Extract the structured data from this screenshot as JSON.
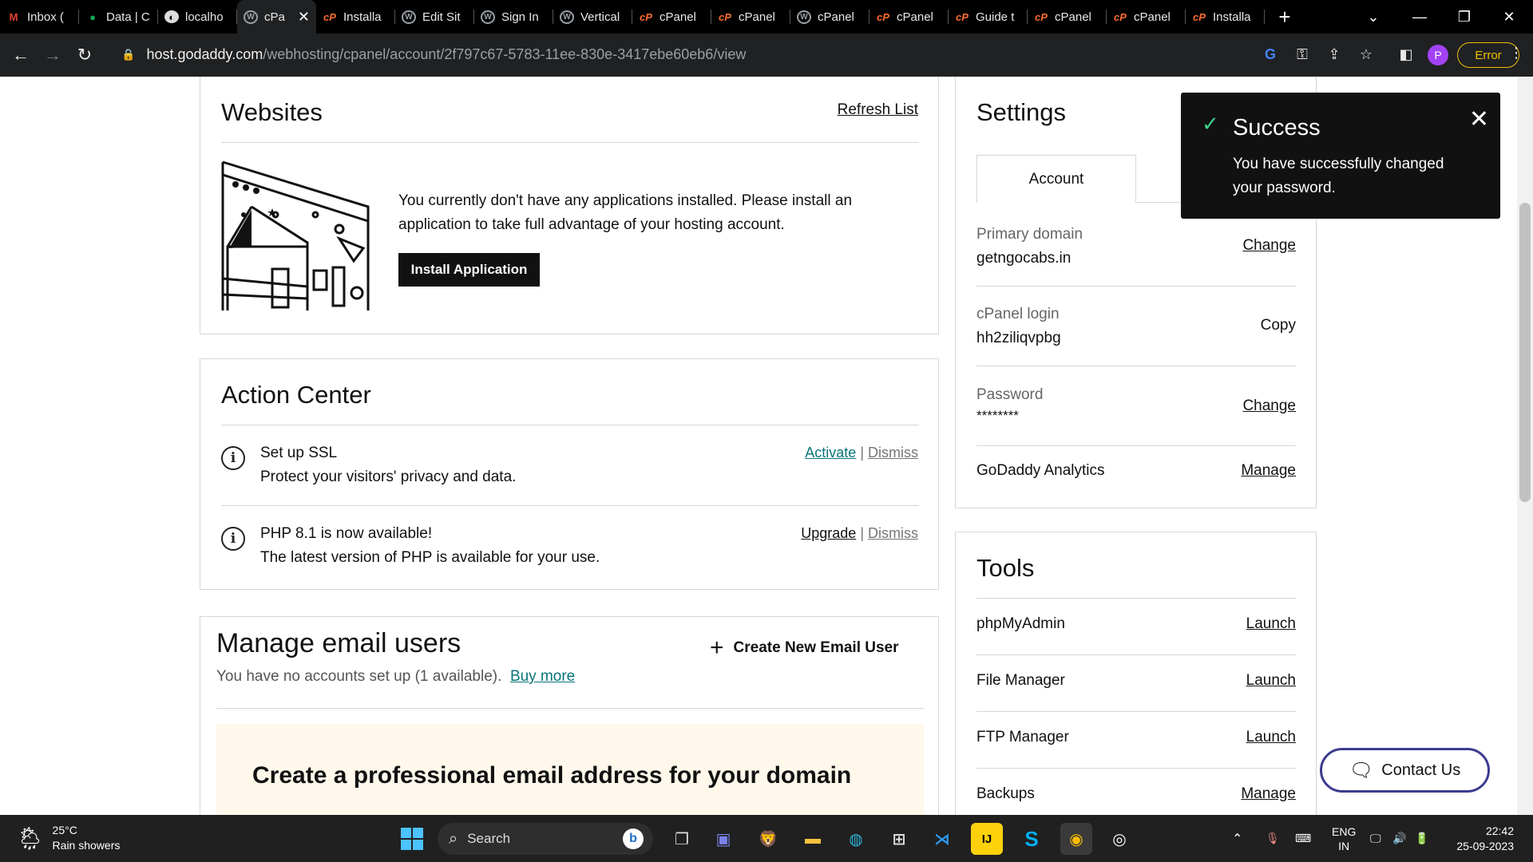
{
  "browser": {
    "tabs": [
      {
        "label": "Inbox (",
        "fav": "M",
        "fclass": "fav-gmail"
      },
      {
        "label": "Data | C",
        "fav": "●",
        "fclass": "fav-mongo"
      },
      {
        "label": "localho",
        "fav": "◐",
        "fclass": "fav-local"
      },
      {
        "label": "cPa",
        "fav": "W",
        "fclass": "fav-wp",
        "active": true
      },
      {
        "label": "Installa",
        "fav": "cP",
        "fclass": "fav-cpanel"
      },
      {
        "label": "Edit Sit",
        "fav": "W",
        "fclass": "fav-wp"
      },
      {
        "label": "Sign In",
        "fav": "W",
        "fclass": "fav-wp"
      },
      {
        "label": "Vertical",
        "fav": "W",
        "fclass": "fav-wp"
      },
      {
        "label": "cPanel",
        "fav": "cP",
        "fclass": "fav-cpanel"
      },
      {
        "label": "cPanel",
        "fav": "cP",
        "fclass": "fav-cpanel"
      },
      {
        "label": "cPanel",
        "fav": "W",
        "fclass": "fav-wp"
      },
      {
        "label": "cPanel",
        "fav": "cP",
        "fclass": "fav-cpanel"
      },
      {
        "label": "Guide t",
        "fav": "cP",
        "fclass": "fav-cpanel"
      },
      {
        "label": "cPanel",
        "fav": "cP",
        "fclass": "fav-cpanel"
      },
      {
        "label": "cPanel",
        "fav": "cP",
        "fclass": "fav-cpanel"
      },
      {
        "label": "Installa",
        "fav": "cP",
        "fclass": "fav-cpanel"
      }
    ],
    "url_host": "host.godaddy.com",
    "url_path": "/webhosting/cpanel/account/2f797c67-5783-11ee-830e-3417ebe60eb6/view",
    "profile_initial": "P",
    "error_label": "Error"
  },
  "websites": {
    "title": "Websites",
    "refresh": "Refresh List",
    "message": "You currently don't have any applications installed. Please install an application to take full advantage of your hosting account.",
    "install_button": "Install Application"
  },
  "action_center": {
    "title": "Action Center",
    "items": [
      {
        "title": "Set up SSL",
        "desc": "Protect your visitors' privacy and data.",
        "action": "Activate",
        "dismiss": "Dismiss"
      },
      {
        "title": "PHP 8.1 is now available!",
        "desc": "The latest version of PHP is available for your use.",
        "action": "Upgrade",
        "dismiss": "Dismiss"
      }
    ]
  },
  "manage_email": {
    "title": "Manage email users",
    "create": "Create New Email User",
    "status": "You have no accounts set up (1 available).",
    "buy_more": "Buy more",
    "promo_title": "Create a professional email address for your domain"
  },
  "settings": {
    "title": "Settings",
    "tab": "Account",
    "rows": [
      {
        "label": "Primary domain",
        "value": "getngocabs.in",
        "action": "Change"
      },
      {
        "label": "cPanel login",
        "value": "hh2ziliqvpbg",
        "action": "Copy"
      },
      {
        "label": "Password",
        "value": "********",
        "action": "Change"
      },
      {
        "label": "GoDaddy Analytics",
        "value": "",
        "action": "Manage"
      }
    ]
  },
  "tools": {
    "title": "Tools",
    "rows": [
      {
        "label": "phpMyAdmin",
        "action": "Launch"
      },
      {
        "label": "File Manager",
        "action": "Launch"
      },
      {
        "label": "FTP Manager",
        "action": "Launch"
      },
      {
        "label": "Backups",
        "action": "Manage"
      }
    ]
  },
  "toast": {
    "title": "Success",
    "message": "You have successfully changed your password."
  },
  "contact": "Contact Us",
  "taskbar": {
    "temp": "25°C",
    "weather": "Rain showers",
    "search": "Search",
    "lang1": "ENG",
    "lang2": "IN",
    "time": "22:42",
    "date": "25-09-2023"
  }
}
